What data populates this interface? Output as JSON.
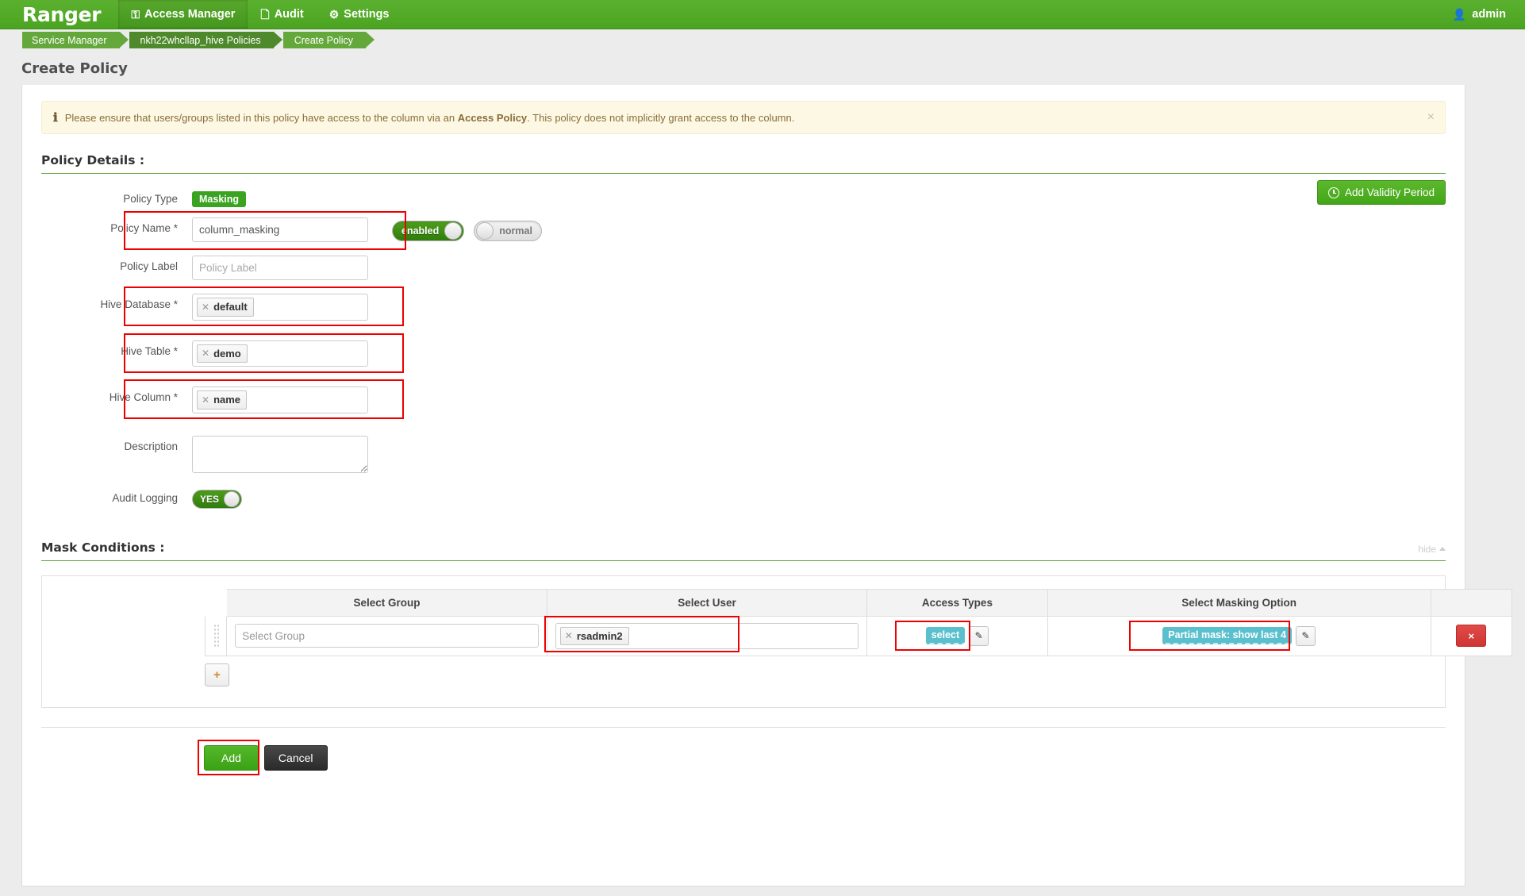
{
  "topnav": {
    "brand": "Ranger",
    "items": [
      {
        "label": "Access Manager",
        "icon": "shield-icon",
        "glyph": "☖",
        "active": true
      },
      {
        "label": "Audit",
        "icon": "file-icon",
        "glyph": "὜B",
        "active": false
      },
      {
        "label": "Settings",
        "icon": "gear-icon",
        "glyph": "⚙",
        "active": false
      }
    ],
    "user": "admin",
    "user_icon": "user-icon"
  },
  "breadcrumb": {
    "items": [
      "Service Manager",
      "nkh22whcllap_hive Policies",
      "Create Policy"
    ]
  },
  "page": {
    "title": "Create Policy"
  },
  "alert": {
    "icon": "info-icon",
    "text_before": "Please ensure that users/groups listed in this policy have access to the column via an ",
    "bold": "Access Policy",
    "text_after": ". This policy does not implicitly grant access to the column.",
    "close_label": "×"
  },
  "policy_details": {
    "section_title": "Policy Details :",
    "validity_button": "Add Validity Period",
    "fields": {
      "policy_type": {
        "label": "Policy Type",
        "value": "Masking"
      },
      "policy_name": {
        "label": "Policy Name *",
        "value": "column_masking",
        "placeholder": "Policy Name"
      },
      "policy_label": {
        "label": "Policy Label",
        "value": "",
        "placeholder": "Policy Label"
      },
      "hive_database": {
        "label": "Hive Database *",
        "tokens": [
          "default"
        ]
      },
      "hive_table": {
        "label": "Hive Table *",
        "tokens": [
          "demo"
        ]
      },
      "hive_column": {
        "label": "Hive Column *",
        "tokens": [
          "name"
        ]
      },
      "description": {
        "label": "Description",
        "value": "",
        "placeholder": ""
      },
      "audit_logging": {
        "label": "Audit Logging",
        "value": "YES"
      }
    },
    "toggles": {
      "status": "enabled",
      "priority": "normal"
    }
  },
  "mask_conditions": {
    "section_title": "Mask Conditions :",
    "hide_label": "hide",
    "columns": [
      "Select Group",
      "Select User",
      "Access Types",
      "Select Masking Option"
    ],
    "rows": [
      {
        "group_placeholder": "Select Group",
        "group_value": "",
        "user_tokens": [
          "rsadmin2"
        ],
        "access_types": [
          "select"
        ],
        "masking_option": "Partial mask: show last 4",
        "delete_label": "×"
      }
    ],
    "add_row_label": "+"
  },
  "footer": {
    "add_label": "Add",
    "cancel_label": "Cancel"
  },
  "colors": {
    "brand_green": "#4ba421",
    "accent_green": "#6ba63c",
    "chip_teal": "#5bc0ce",
    "danger_red": "#cf3633",
    "highlight_red": "#ee0000",
    "alert_bg": "#fcf8e3"
  }
}
